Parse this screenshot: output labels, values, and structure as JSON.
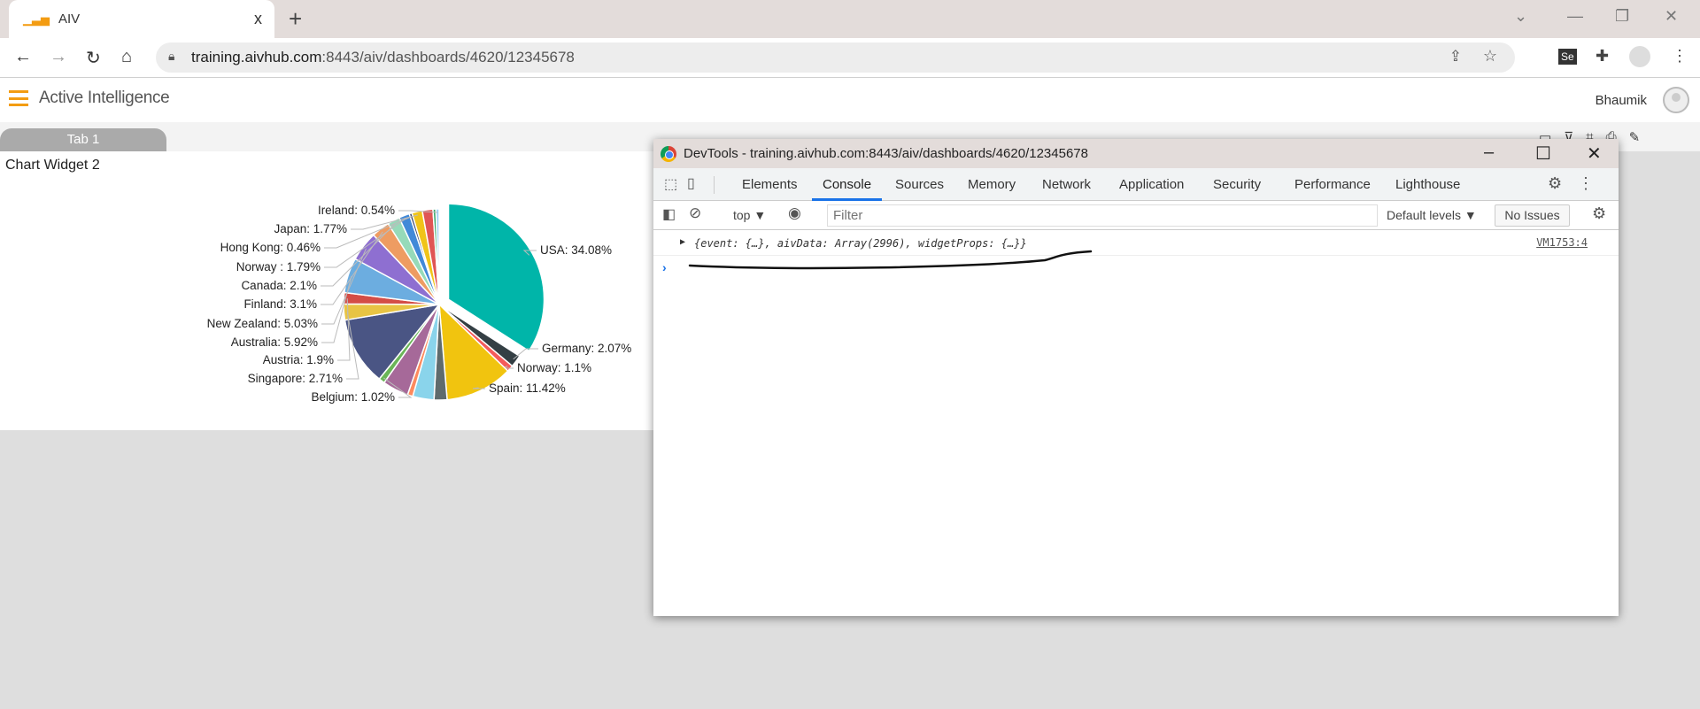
{
  "browser": {
    "tab_title": "AIV",
    "tab_close": "x",
    "new_tab": "+",
    "url_host": "training.aivhub.com",
    "url_path": ":8443/aiv/dashboards/4620/12345678",
    "window_controls": {
      "chevron": "⌄",
      "minimize": "—",
      "restore": "❐",
      "close": "✕"
    }
  },
  "app": {
    "title": "Active Intelligence",
    "user": "Bhaumik",
    "tab": "Tab 1"
  },
  "widget": {
    "title": "Chart Widget 2"
  },
  "devtools": {
    "title": "DevTools - training.aivhub.com:8443/aiv/dashboards/4620/12345678",
    "tabs": [
      "Elements",
      "Console",
      "Sources",
      "Memory",
      "Network",
      "Application",
      "Security",
      "Performance",
      "Lighthouse"
    ],
    "active_tab": "Console",
    "context": "top ▼",
    "filter_placeholder": "Filter",
    "levels": "Default levels ▼",
    "issues": "No Issues",
    "log": {
      "text": "{event: {…}, aivData: Array(2996), widgetProps: {…}}",
      "source": "VM1753:4"
    },
    "prompt": "›"
  },
  "chart_data": {
    "type": "pie",
    "exploded": "USA",
    "slices": [
      {
        "name": "USA",
        "value": 34.08,
        "label": "USA: 34.08%",
        "color": "#00b5a9"
      },
      {
        "name": "Germany",
        "value": 2.07,
        "label": "Germany: 2.07%",
        "color": "#343f44"
      },
      {
        "name": "Norway",
        "value": 1.1,
        "label": "Norway: 1.1%",
        "color": "#f45b5b"
      },
      {
        "name": "Spain",
        "value": 11.42,
        "label": "Spain: 11.42%",
        "color": "#f1c40f"
      },
      {
        "value": 2.2,
        "color": "#5f6b6d"
      },
      {
        "value": 3.6,
        "color": "#8ad4eb"
      },
      {
        "value": 0.9,
        "color": "#fd8a5e"
      },
      {
        "value": 4.4,
        "color": "#a66999"
      },
      {
        "name": "Belgium",
        "value": 1.02,
        "label": "Belgium: 1.02%",
        "color": "#6ab557"
      },
      {
        "value": 11.6,
        "color": "#4a5584"
      },
      {
        "name": "Singapore",
        "value": 2.71,
        "label": "Singapore: 2.71%",
        "color": "#e8c444"
      },
      {
        "name": "Austria",
        "value": 1.9,
        "label": "Austria: 1.9%",
        "color": "#d44d46"
      },
      {
        "name": "Australia",
        "value": 5.92,
        "label": "Australia: 5.92%",
        "color": "#6cade0"
      },
      {
        "name": "New Zealand",
        "value": 5.03,
        "label": "New Zealand: 5.03%",
        "color": "#8e6fd1"
      },
      {
        "name": "Finland",
        "value": 3.1,
        "label": "Finland: 3.1%",
        "color": "#ee9c62"
      },
      {
        "name": "Canada",
        "value": 2.1,
        "label": "Canada: 2.1%",
        "color": "#96dab9"
      },
      {
        "name": "Norway ",
        "value": 1.79,
        "label": "Norway : 1.79%",
        "color": "#4189d8"
      },
      {
        "name": "Hong Kong",
        "value": 0.46,
        "label": "Hong Kong: 0.46%",
        "color": "#3c4a70"
      },
      {
        "name": "Japan",
        "value": 1.77,
        "label": "Japan: 1.77%",
        "color": "#f0c419"
      },
      {
        "value": 1.8,
        "color": "#e05555"
      },
      {
        "value": 0.5,
        "color": "#3aa86b"
      },
      {
        "name": "Ireland",
        "value": 0.54,
        "label": "Ireland: 0.54%",
        "color": "#9fd0f5"
      }
    ]
  }
}
